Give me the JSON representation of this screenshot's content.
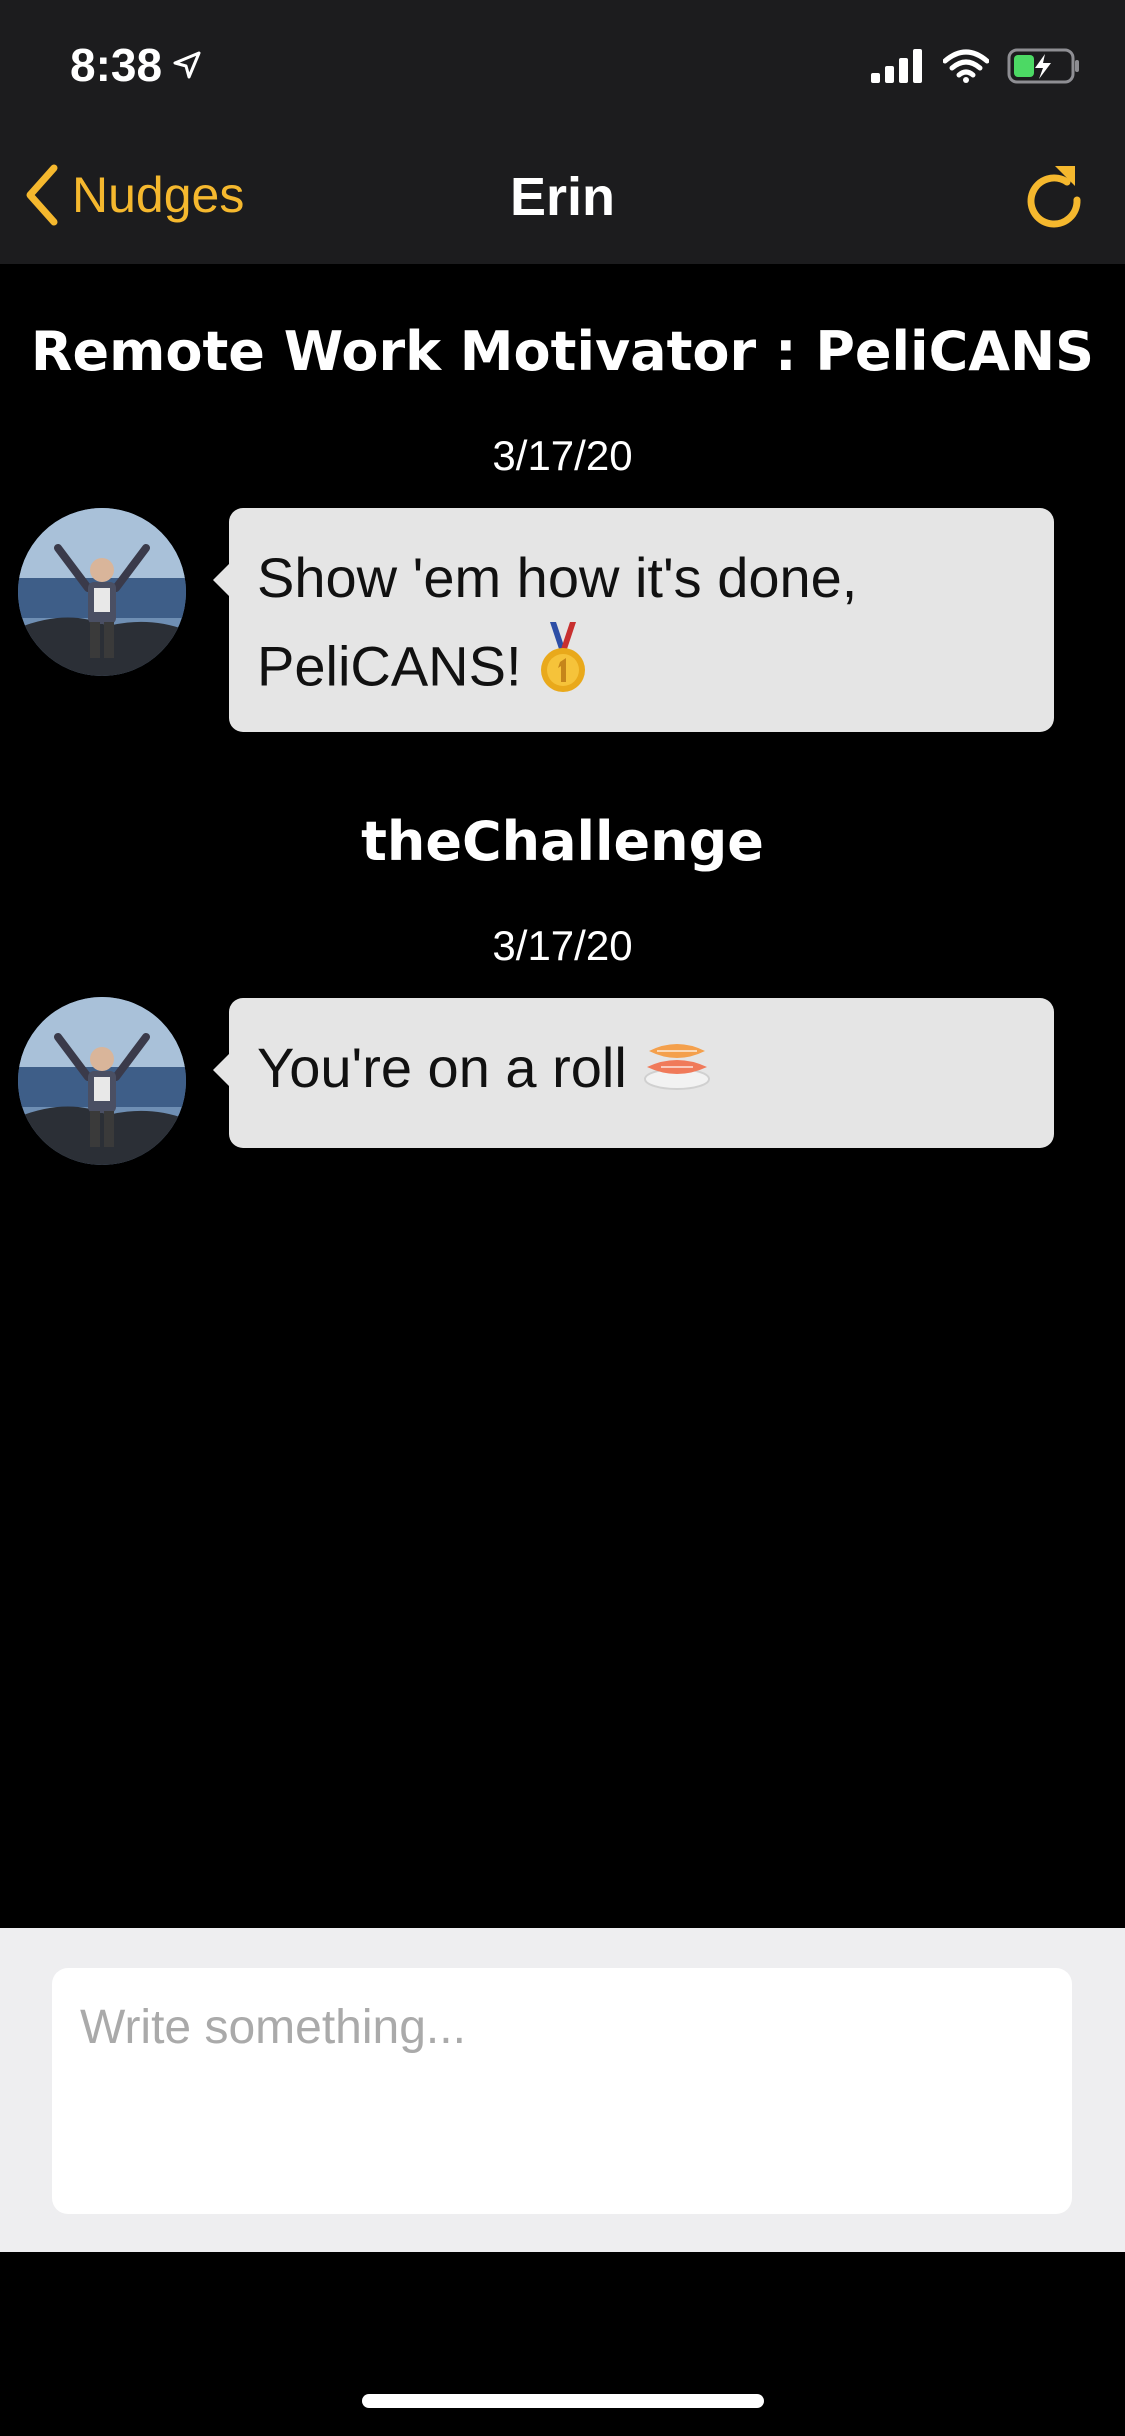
{
  "status_bar": {
    "time": "8:38",
    "icons": [
      "location-arrow-icon",
      "signal-icon",
      "wifi-icon",
      "battery-charging-icon"
    ]
  },
  "nav": {
    "back_label": "Nudges",
    "title": "Erin",
    "accent_color": "#f5b82e"
  },
  "messages": [
    {
      "group_title": "Remote Work Motivator : PeliCANS",
      "date": "3/17/20",
      "line1": "Show 'em how it's done,",
      "line2": "PeliCANS!",
      "emoji": "medal-emoji"
    },
    {
      "group_title": "theChallenge",
      "date": "3/17/20",
      "text": "You're on a roll",
      "emoji": "sushi-emoji"
    }
  ],
  "composer": {
    "placeholder": "Write something..."
  }
}
